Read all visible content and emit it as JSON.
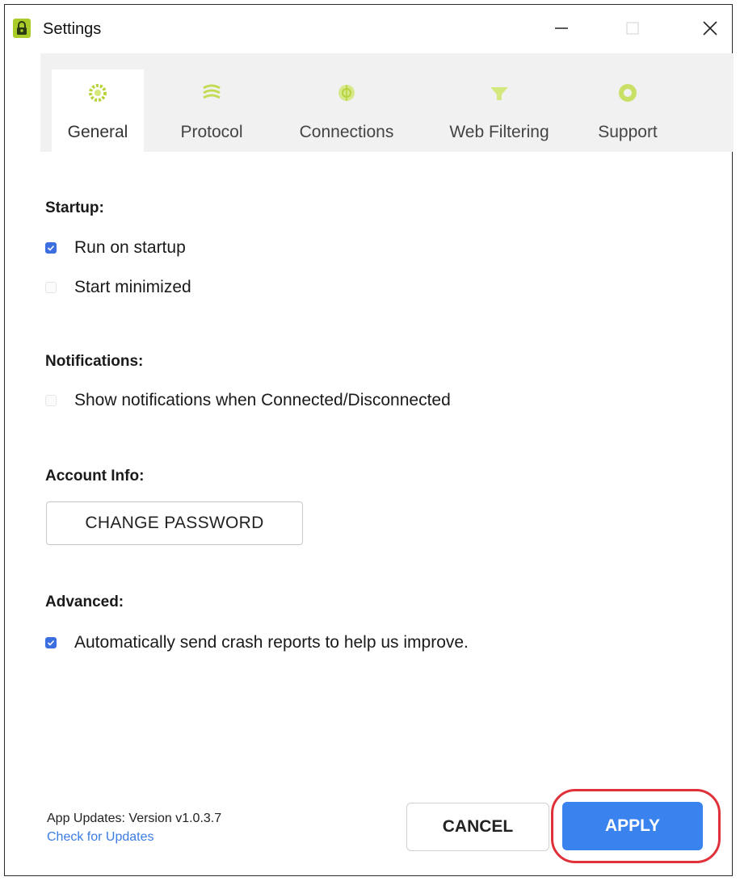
{
  "window": {
    "title": "Settings",
    "icon": "lock-icon"
  },
  "tabs": [
    {
      "label": "General",
      "icon": "gear-icon",
      "active": true
    },
    {
      "label": "Protocol",
      "icon": "protocol-icon",
      "active": false
    },
    {
      "label": "Connections",
      "icon": "connections-icon",
      "active": false
    },
    {
      "label": "Web Filtering",
      "icon": "filter-icon",
      "active": false
    },
    {
      "label": "Support",
      "icon": "support-icon",
      "active": false
    }
  ],
  "sections": {
    "startup": {
      "title": "Startup:",
      "options": [
        {
          "label": "Run on startup",
          "checked": true
        },
        {
          "label": "Start minimized",
          "checked": false
        }
      ]
    },
    "notifications": {
      "title": "Notifications:",
      "options": [
        {
          "label": "Show notifications when Connected/Disconnected",
          "checked": false
        }
      ]
    },
    "account": {
      "title": "Account Info:",
      "change_password_label": "CHANGE PASSWORD"
    },
    "advanced": {
      "title": "Advanced:",
      "options": [
        {
          "label": "Automatically send crash reports to help us improve.",
          "checked": true
        }
      ]
    }
  },
  "footer": {
    "version_text": "App Updates: Version v1.0.3.7",
    "check_updates_label": "Check for Updates",
    "cancel_label": "CANCEL",
    "apply_label": "APPLY"
  },
  "colors": {
    "accent_green": "#b6d33a",
    "checkbox_blue": "#3b6fe0",
    "apply_blue": "#3a82ee",
    "link_blue": "#3b7be6",
    "highlight_red": "#e0303a"
  }
}
